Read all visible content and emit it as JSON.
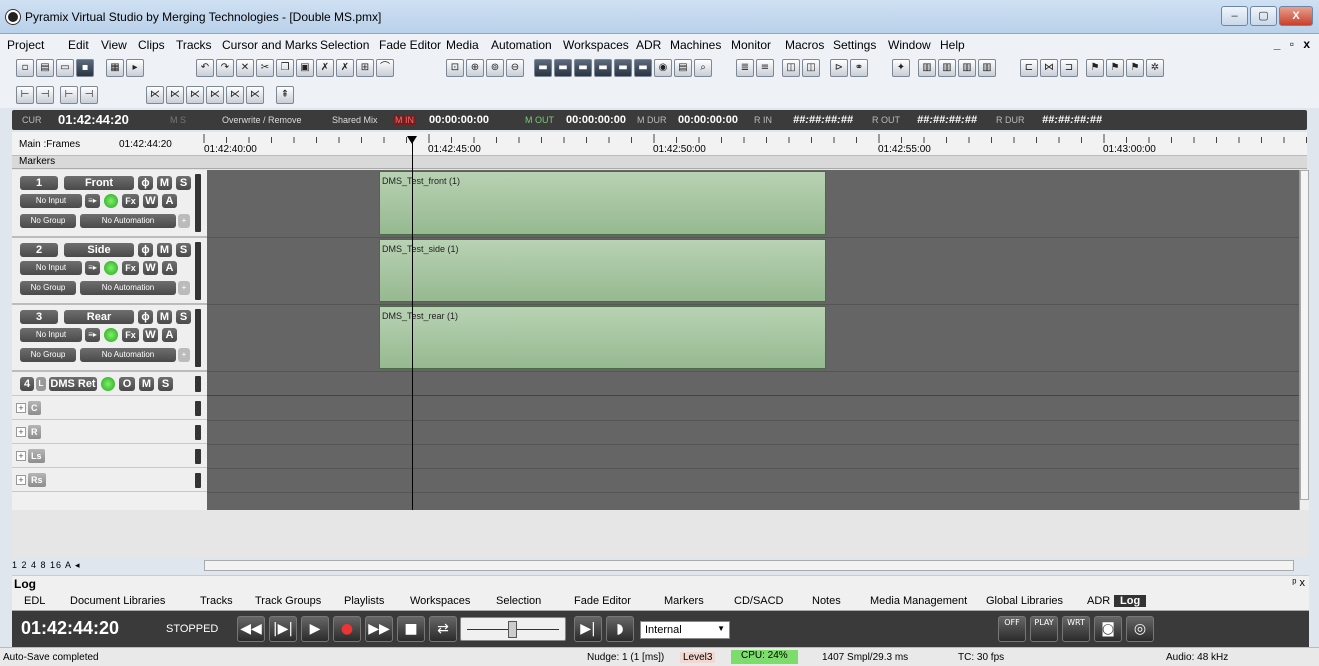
{
  "window": {
    "title": "Pyramix Virtual Studio by Merging Technologies - [Double MS.pmx]",
    "controls": {
      "minimize": "–",
      "maximize": "▢",
      "close": "X"
    },
    "mdi": "_ ▫ x"
  },
  "menu": [
    "Project",
    "Edit",
    "View",
    "Clips",
    "Tracks",
    "Cursor and Marks",
    "Selection",
    "Fade Editor",
    "Media",
    "Automation",
    "Workspaces",
    "ADR",
    "Machines",
    "Monitor",
    "Macros",
    "Settings",
    "Window",
    "Help"
  ],
  "transport": {
    "cur_label": "CUR",
    "cur_value": "01:42:44:20",
    "ms": "M  S",
    "mode": "Overwrite / Remove",
    "mix": "Shared Mix",
    "m_in_label": "M IN",
    "m_in": "00:00:00:00",
    "m_out_label": "M OUT",
    "m_out": "00:00:00:00",
    "m_dur_label": "M DUR",
    "m_dur": "00:00:00:00",
    "r_in_label": "R IN",
    "r_in": "##:##:##:##",
    "r_out_label": "R OUT",
    "r_out": "##:##:##:##",
    "r_dur_label": "R DUR",
    "r_dur": "##:##:##:##"
  },
  "ruler": {
    "main_label": "Main :Frames",
    "main_value": "01:42:44:20",
    "ticks": [
      "01:42:40:00",
      "01:42:45:00",
      "01:42:50:00",
      "01:42:55:00",
      "01:43:00:00"
    ]
  },
  "markers_label": "Markers",
  "tracks": [
    {
      "num": "1",
      "name": "Front",
      "input": "No Input",
      "group": "No Group",
      "automation": "No Automation",
      "clip": "DMS_Test_front (1)"
    },
    {
      "num": "2",
      "name": "Side",
      "input": "No Input",
      "group": "No Group",
      "automation": "No Automation",
      "clip": "DMS_Test_side (1)"
    },
    {
      "num": "3",
      "name": "Rear",
      "input": "No Input",
      "group": "No Group",
      "automation": "No Automation",
      "clip": "DMS_Test_rear (1)"
    }
  ],
  "dms": {
    "num": "4",
    "l": "L",
    "name": "DMS Ret",
    "channels": [
      "C",
      "R",
      "Ls",
      "Rs"
    ]
  },
  "track_buttons": {
    "phase": "ϕ",
    "mute": "M",
    "solo": "S",
    "fx": "Fx",
    "write": "W",
    "auto": "A",
    "rec": "O",
    "insert": "≡▸",
    "plus": "+"
  },
  "zoom": "1 2 4 8 16 A ◂",
  "log_title": "Log",
  "log_pin": "ᵖ x",
  "tabs": [
    "EDL",
    "Document Libraries",
    "Tracks",
    "Track Groups",
    "Playlists",
    "Workspaces",
    "Selection",
    "Fade Editor",
    "Markers",
    "CD/SACD",
    "Notes",
    "Media Management",
    "Global Libraries",
    "ADR",
    "Log"
  ],
  "bottom": {
    "timecode": "01:42:44:20",
    "state": "STOPPED",
    "sync": "Internal",
    "icons": [
      "OFF",
      "PLAY",
      "WRT"
    ]
  },
  "status": {
    "left": "Auto-Save completed",
    "nudge": "Nudge: 1 (1 [ms])",
    "level": "Level3",
    "cpu": "CPU: 24%",
    "smpl": "1407 Smpl/29.3 ms",
    "tc": "TC: 30 fps",
    "audio": "Audio: 48 kHz"
  }
}
